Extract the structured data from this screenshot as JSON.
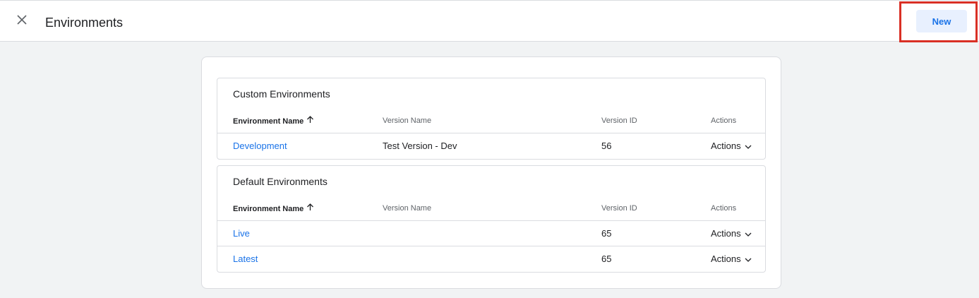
{
  "header": {
    "title": "Environments",
    "close_icon": "close-icon",
    "new_label": "New",
    "highlight_color": "#d93025"
  },
  "columns": {
    "name": "Environment Name",
    "version_name": "Version Name",
    "version_id": "Version ID",
    "actions": "Actions"
  },
  "custom": {
    "title": "Custom Environments",
    "rows": [
      {
        "name": "Development",
        "version_name": "Test Version - Dev",
        "version_id": "56",
        "actions": "Actions"
      }
    ]
  },
  "default": {
    "title": "Default Environments",
    "rows": [
      {
        "name": "Live",
        "version_name": "",
        "version_id": "65",
        "actions": "Actions"
      },
      {
        "name": "Latest",
        "version_name": "",
        "version_id": "65",
        "actions": "Actions"
      }
    ]
  },
  "colors": {
    "accent": "#1a73e8",
    "background": "#f1f3f4"
  }
}
